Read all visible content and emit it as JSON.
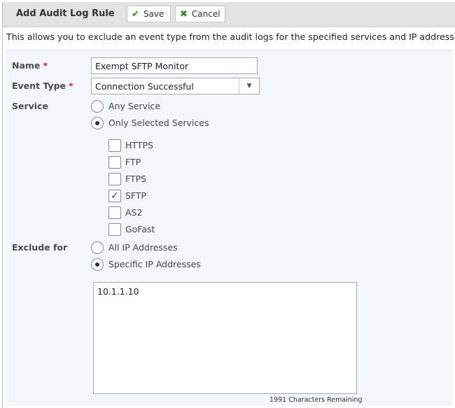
{
  "header": {
    "title": "Add Audit Log Rule",
    "save_label": "Save",
    "cancel_label": "Cancel",
    "save_icon": "✔",
    "cancel_icon": "✖"
  },
  "description": "This allows you to exclude an event type from the audit logs for the specified services and IP addresses.",
  "form": {
    "name_label": "Name",
    "name_value": "Exempt SFTP Monitor",
    "event_type_label": "Event Type",
    "event_type_value": "Connection Successful",
    "required_marker": "*",
    "service_label": "Service",
    "service_options": [
      {
        "label": "Any Service",
        "selected": false
      },
      {
        "label": "Only Selected Services",
        "selected": true
      }
    ],
    "services": [
      {
        "label": "HTTPS",
        "checked": false
      },
      {
        "label": "FTP",
        "checked": false
      },
      {
        "label": "FTPS",
        "checked": false
      },
      {
        "label": "SFTP",
        "checked": true
      },
      {
        "label": "AS2",
        "checked": false
      },
      {
        "label": "GoFast",
        "checked": false
      }
    ],
    "exclude_label": "Exclude for",
    "exclude_options": [
      {
        "label": "All IP Addresses",
        "selected": false
      },
      {
        "label": "Specific IP Addresses",
        "selected": true
      }
    ],
    "ip_addresses": "10.1.1.10",
    "remaining_text": "1991 Characters Remaining"
  },
  "colors": {
    "header_bg": "#e3e3e3",
    "panel_bg": "#f3f7fc",
    "required": "#d32f2f",
    "icon_green": "#2e8b1f"
  }
}
